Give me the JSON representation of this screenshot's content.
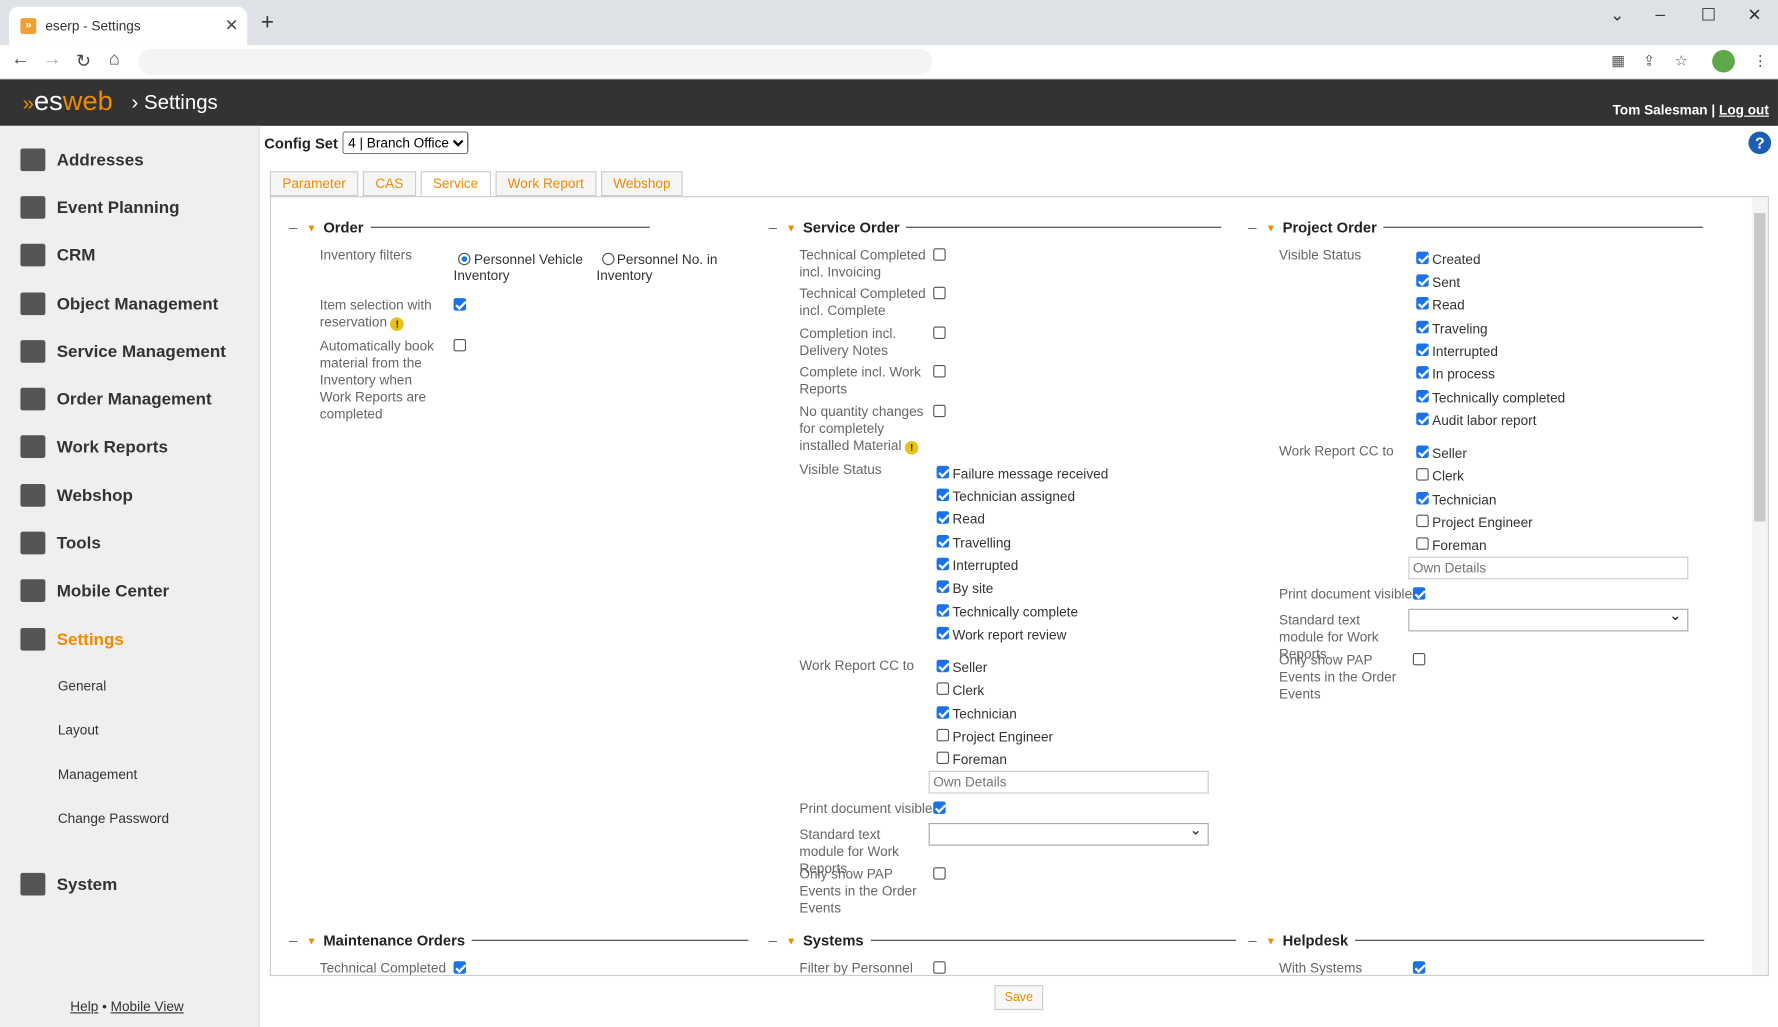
{
  "browser": {
    "tab_title": "eserp - Settings",
    "close": "✕",
    "new_tab": "+"
  },
  "header": {
    "logo_es": "es",
    "logo_web": "web",
    "section": "Settings",
    "user_name": "Tom Salesman",
    "separator": "|",
    "logout": "Log out"
  },
  "sidebar": {
    "items": [
      {
        "label": "Addresses",
        "icon": "addresses-icon"
      },
      {
        "label": "Event Planning",
        "icon": "calendar-icon"
      },
      {
        "label": "CRM",
        "icon": "people-icon"
      },
      {
        "label": "Object Management",
        "icon": "factory-icon"
      },
      {
        "label": "Service Management",
        "icon": "headset-icon"
      },
      {
        "label": "Order Management",
        "icon": "list-icon"
      },
      {
        "label": "Work Reports",
        "icon": "clipboard-icon"
      },
      {
        "label": "Webshop",
        "icon": "cart-icon"
      },
      {
        "label": "Tools",
        "icon": "tools-icon"
      },
      {
        "label": "Mobile Center",
        "icon": "mobile-icon"
      },
      {
        "label": "Settings",
        "icon": "gears-icon",
        "active": true
      },
      {
        "label": "System",
        "icon": "database-icon"
      }
    ],
    "subitems": [
      "General",
      "Layout",
      "Management",
      "Change Password"
    ],
    "footer": {
      "help": "Help",
      "dot": "•",
      "mobile_view": "Mobile View"
    }
  },
  "config": {
    "label": "Config Set",
    "value": "4 | Branch Office"
  },
  "tabs": [
    "Parameter",
    "CAS",
    "Service",
    "Work Report",
    "Webshop"
  ],
  "active_tab": "Service",
  "order": {
    "title": "Order",
    "inventory_filters": "Inventory filters",
    "opt1": "Personnel Vehicle Inventory",
    "opt2": "Personnel No. in Inventory",
    "item_selection": "Item selection with reservation",
    "auto_book": "Automatically book material from the Inventory when Work Reports are completed"
  },
  "service_order": {
    "title": "Service Order",
    "tc_invoicing": "Technical Completed incl. Invoicing",
    "tc_complete": "Technical Completed incl. Complete",
    "completion_delivery": "Completion incl. Delivery Notes",
    "complete_work": "Complete incl. Work Reports",
    "no_qty": "No quantity changes for completely installed Material",
    "visible_status": "Visible Status",
    "statuses": [
      "Failure message received",
      "Technician assigned",
      "Read",
      "Travelling",
      "Interrupted",
      "By site",
      "Technically complete",
      "Work report review"
    ],
    "work_report_cc": "Work Report CC to",
    "cc": [
      {
        "label": "Seller",
        "on": true
      },
      {
        "label": "Clerk",
        "on": false
      },
      {
        "label": "Technician",
        "on": true
      },
      {
        "label": "Project Engineer",
        "on": false
      },
      {
        "label": "Foreman",
        "on": false
      }
    ],
    "own_details": "Own Details",
    "print_doc": "Print document visible",
    "std_text": "Standard text module for Work Reports",
    "only_pap": "Only show PAP Events in the Order Events"
  },
  "project_order": {
    "title": "Project Order",
    "visible_status": "Visible Status",
    "statuses": [
      "Created",
      "Sent",
      "Read",
      "Traveling",
      "Interrupted",
      "In process",
      "Technically completed",
      "Audit labor report"
    ],
    "work_report_cc": "Work Report CC to",
    "cc": [
      {
        "label": "Seller",
        "on": true
      },
      {
        "label": "Clerk",
        "on": false
      },
      {
        "label": "Technician",
        "on": true
      },
      {
        "label": "Project Engineer",
        "on": false
      },
      {
        "label": "Foreman",
        "on": false
      }
    ],
    "own_details": "Own Details",
    "print_doc": "Print document visible",
    "std_text": "Standard text module for Work Reports",
    "only_pap": "Only show PAP Events in the Order Events"
  },
  "maintenance": {
    "title": "Maintenance Orders",
    "tech_completed": "Technical Completed"
  },
  "systems": {
    "title": "Systems",
    "filter_personnel": "Filter by Personnel"
  },
  "helpdesk": {
    "title": "Helpdesk",
    "with_systems": "With Systems"
  },
  "save_label": "Save"
}
